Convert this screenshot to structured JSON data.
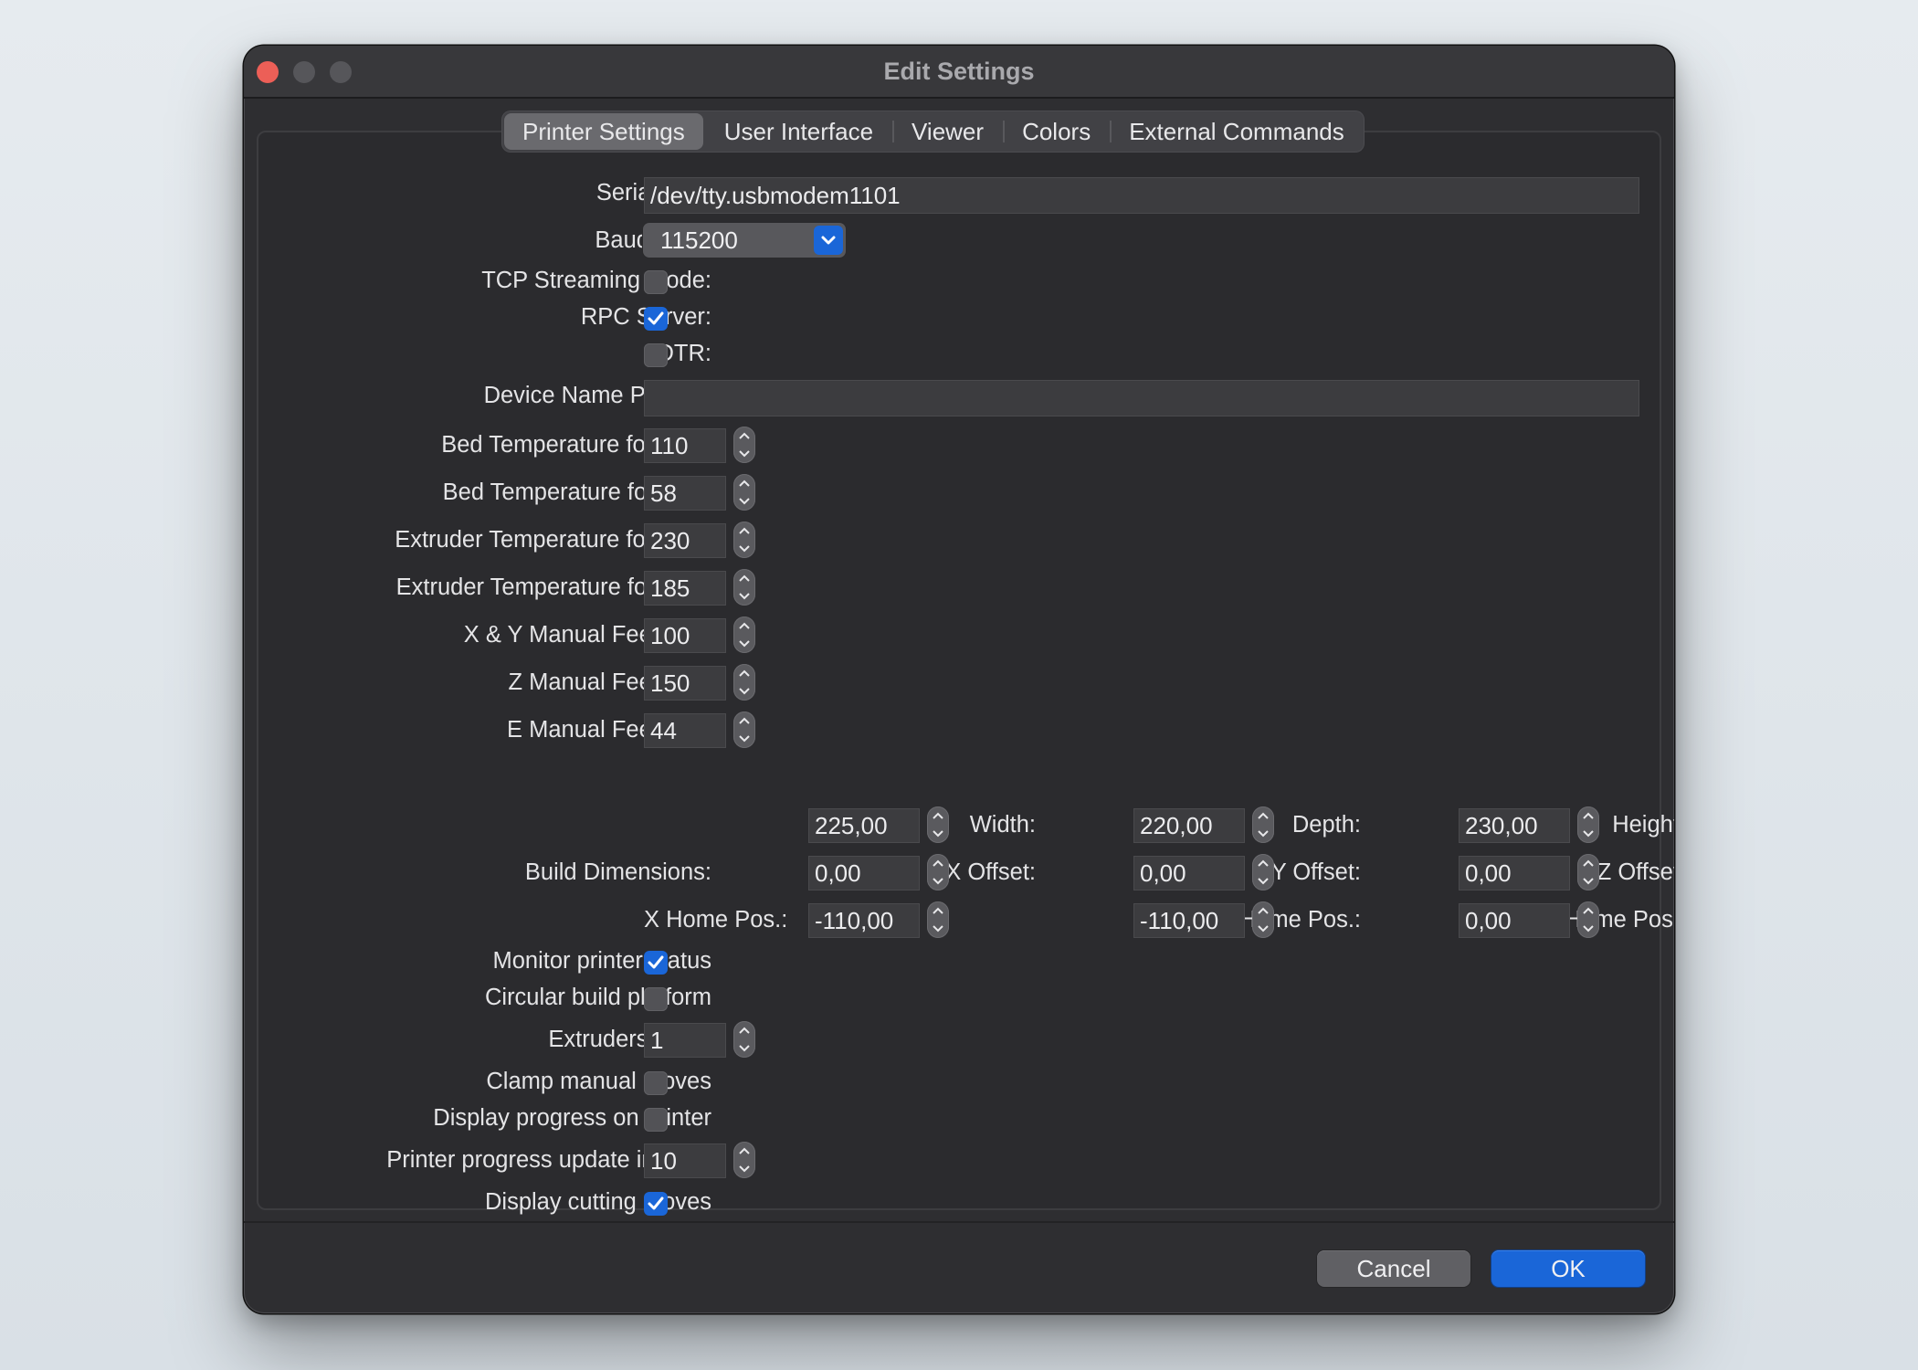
{
  "window": {
    "title": "Edit Settings"
  },
  "tabs": [
    {
      "label": "Printer Settings",
      "active": true
    },
    {
      "label": "User Interface",
      "active": false
    },
    {
      "label": "Viewer",
      "active": false
    },
    {
      "label": "Colors",
      "active": false
    },
    {
      "label": "External Commands",
      "active": false
    }
  ],
  "form": {
    "serial_port": {
      "label": "Serial Port:",
      "value": "/dev/tty.usbmodem1101"
    },
    "baud_rate": {
      "label": "Baud Rate:",
      "value": "115200"
    },
    "tcp_streaming": {
      "label": "TCP Streaming Mode:",
      "checked": false
    },
    "rpc_server": {
      "label": "RPC Server:",
      "checked": true
    },
    "dtr": {
      "label": "DTR:",
      "checked": false
    },
    "device_name_pattern": {
      "label": "Device Name Pattern:",
      "value": ""
    },
    "bed_temp_abs": {
      "label": "Bed Temperature for ABS:",
      "value": "110"
    },
    "bed_temp_pla": {
      "label": "Bed Temperature for PLA:",
      "value": "58"
    },
    "extruder_temp_abs": {
      "label": "Extruder Temperature for ABS:",
      "value": "230"
    },
    "extruder_temp_pla": {
      "label": "Extruder Temperature for PLA:",
      "value": "185"
    },
    "xy_feedrate": {
      "label": "X & Y Manual Feedrate:",
      "value": "100"
    },
    "z_feedrate": {
      "label": "Z Manual Feedrate:",
      "value": "150"
    },
    "e_feedrate": {
      "label": "E Manual Feedrate:",
      "value": "44"
    },
    "build_dimensions": {
      "label": "Build Dimensions:",
      "width": {
        "label": "Width:",
        "value": "225,00"
      },
      "depth": {
        "label": "Depth:",
        "value": "220,00"
      },
      "height": {
        "label": "Height:",
        "value": "230,00"
      },
      "x_offset": {
        "label": "X Offset:",
        "value": "0,00"
      },
      "y_offset": {
        "label": "Y Offset:",
        "value": "0,00"
      },
      "z_offset": {
        "label": "Z Offset:",
        "value": "0,00"
      },
      "x_home": {
        "label": "X Home Pos.:",
        "value": "-110,00"
      },
      "y_home": {
        "label": "Y Home Pos.:",
        "value": "-110,00"
      },
      "z_home": {
        "label": "Z Home Pos.:",
        "value": "0,00"
      }
    },
    "monitor_status": {
      "label": "Monitor printer status",
      "checked": true
    },
    "circular_platform": {
      "label": "Circular build platform",
      "checked": false
    },
    "extruders_count": {
      "label": "Extruders count",
      "value": "1"
    },
    "clamp_moves": {
      "label": "Clamp manual moves",
      "checked": false
    },
    "display_progress": {
      "label": "Display progress on printer",
      "checked": false
    },
    "progress_interval": {
      "label": "Printer progress update interval",
      "value": "10"
    },
    "display_cutting": {
      "label": "Display cutting moves",
      "checked": true
    }
  },
  "buttons": {
    "cancel": "Cancel",
    "ok": "OK"
  },
  "colors": {
    "accent": "#1a66d8",
    "window_bg": "#2e2e31",
    "close_button": "#ec5f57"
  }
}
